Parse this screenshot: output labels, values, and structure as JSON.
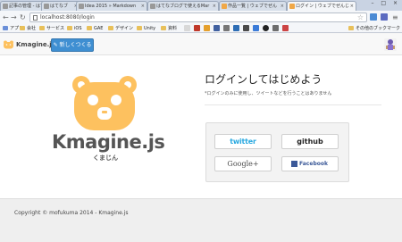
{
  "browser": {
    "tabs": [
      {
        "label": "記事の管理 - はてなブ"
      },
      {
        "label": "はてなブ"
      },
      {
        "label": "Idea 2015 » Markdown"
      },
      {
        "label": "はてなブログで使えるMar"
      },
      {
        "label": "作品一覧 | ウェブでぜん"
      },
      {
        "label": "ログイン | ウェブでぜんじ"
      }
    ],
    "url": "localhost:8080/login",
    "bookmarks": [
      {
        "label": "アプリ"
      },
      {
        "label": "会社"
      },
      {
        "label": "サービス"
      },
      {
        "label": "iOS"
      },
      {
        "label": "GAE"
      },
      {
        "label": "デザイン"
      },
      {
        "label": "Unity"
      },
      {
        "label": "資料"
      }
    ],
    "other_bookmarks": "その他のブックマーク"
  },
  "header": {
    "logo": "Kmagine.js",
    "new_button": "新しくつくる"
  },
  "brand": {
    "name": "Kmagine.js",
    "kana": "くまじん"
  },
  "login": {
    "title": "ログインしてはじめよう",
    "description": "*ログインのみに使用し、ツイートなどを行うことはありません",
    "buttons": {
      "twitter": "twitter",
      "github": "github",
      "google": "Google+",
      "facebook": "Facebook"
    }
  },
  "footer": {
    "copyright": "Copyright © mofukuma 2014 - Kmagine.js"
  },
  "colors": {
    "mascot": "#fdc15f",
    "primary_button": "#3f8fd2",
    "twitter": "#2aa9e0",
    "facebook": "#3b5998"
  }
}
